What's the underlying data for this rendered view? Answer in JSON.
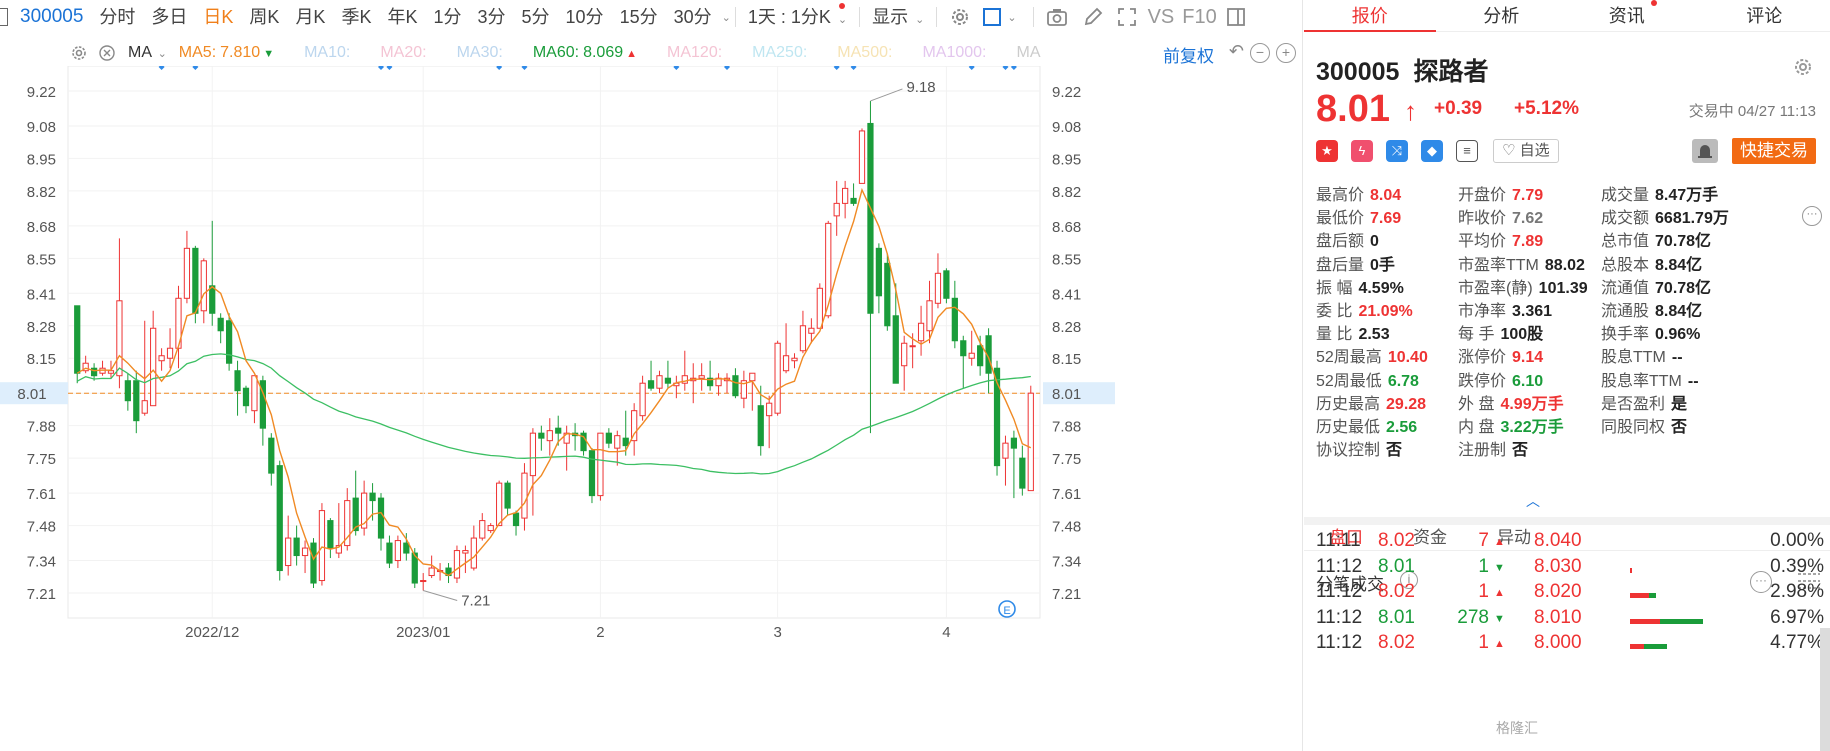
{
  "toolbar": {
    "code": "300005",
    "periods": [
      "分时",
      "多日",
      "日K",
      "周K",
      "月K",
      "季K",
      "年K",
      "1分",
      "3分",
      "5分",
      "10分",
      "15分",
      "30分"
    ],
    "active_period": "日K",
    "interval": "1天 : 1分K",
    "display": "显示",
    "vs": "VS",
    "f10": "F10"
  },
  "ma_bar": {
    "label": "MA",
    "items": [
      {
        "text": "MA5:",
        "value": "7.810",
        "color": "#f08a24",
        "marker": "▼",
        "marker_color": "#1a9c3a"
      },
      {
        "text": "MA10:",
        "value": "",
        "color": "#bcd6ee"
      },
      {
        "text": "MA20:",
        "value": "",
        "color": "#f4c4d4"
      },
      {
        "text": "MA30:",
        "value": "",
        "color": "#bcd6ee"
      },
      {
        "text": "MA60:",
        "value": "8.069",
        "color": "#1a9c3a",
        "marker": "▲",
        "marker_color": "#e33"
      },
      {
        "text": "MA120:",
        "value": "",
        "color": "#f4c4d4"
      },
      {
        "text": "MA250:",
        "value": "",
        "color": "#bfe6f1"
      },
      {
        "text": "MA500:",
        "value": "",
        "color": "#f6e3b4"
      },
      {
        "text": "MA1000:",
        "value": "",
        "color": "#e3c6ee"
      },
      {
        "text": "MA",
        "value": "",
        "color": "#ccc"
      }
    ],
    "adjust": "前复权"
  },
  "chart_data": {
    "type": "candlestick",
    "y_ticks": [
      "9.22",
      "9.08",
      "8.95",
      "8.82",
      "8.68",
      "8.55",
      "8.41",
      "8.28",
      "8.15",
      "8.01",
      "7.88",
      "7.75",
      "7.61",
      "7.48",
      "7.34",
      "7.21"
    ],
    "x_labels": [
      "2022/12",
      "2023/01",
      "2",
      "3",
      "4"
    ],
    "current_price": "8.01",
    "annotations": {
      "high": "9.18",
      "low": "7.21"
    },
    "up_color": "#e33",
    "down_color": "#1a9c3a",
    "ylim": [
      7.11,
      9.32
    ],
    "candles": [
      [
        8.36,
        8.09,
        8.35,
        8.05
      ],
      [
        8.1,
        8.13,
        8.16,
        8.09
      ],
      [
        8.11,
        8.08,
        8.13,
        8.06
      ],
      [
        8.09,
        8.11,
        8.14,
        8.08
      ],
      [
        8.09,
        8.1,
        8.14,
        8.07
      ],
      [
        8.08,
        8.38,
        8.63,
        8.03
      ],
      [
        8.06,
        7.98,
        8.09,
        7.94
      ],
      [
        8.06,
        7.9,
        8.1,
        7.85
      ],
      [
        7.93,
        7.98,
        8.3,
        7.92
      ],
      [
        7.96,
        8.27,
        8.34,
        7.96
      ],
      [
        8.14,
        8.16,
        8.19,
        8.1
      ],
      [
        8.15,
        8.19,
        8.27,
        8.11
      ],
      [
        8.19,
        8.39,
        8.44,
        8.11
      ],
      [
        8.39,
        8.59,
        8.66,
        8.37
      ],
      [
        8.59,
        8.33,
        8.6,
        8.29
      ],
      [
        8.34,
        8.54,
        8.55,
        8.29
      ],
      [
        8.44,
        8.33,
        8.7,
        8.28
      ],
      [
        8.31,
        8.26,
        8.33,
        8.21
      ],
      [
        8.3,
        8.13,
        8.33,
        8.1
      ],
      [
        8.1,
        8.02,
        8.14,
        7.92
      ],
      [
        8.03,
        7.96,
        8.04,
        7.93
      ],
      [
        7.94,
        8.08,
        8.08,
        7.89
      ],
      [
        8.06,
        7.87,
        8.08,
        7.8
      ],
      [
        7.83,
        7.69,
        7.85,
        7.64
      ],
      [
        7.72,
        7.3,
        7.74,
        7.26
      ],
      [
        7.32,
        7.43,
        7.52,
        7.28
      ],
      [
        7.43,
        7.36,
        7.48,
        7.32
      ],
      [
        7.36,
        7.39,
        7.42,
        7.29
      ],
      [
        7.41,
        7.25,
        7.43,
        7.23
      ],
      [
        7.26,
        7.54,
        7.57,
        7.24
      ],
      [
        7.5,
        7.39,
        7.51,
        7.35
      ],
      [
        7.37,
        7.4,
        7.57,
        7.35
      ],
      [
        7.4,
        7.58,
        7.63,
        7.38
      ],
      [
        7.59,
        7.46,
        7.7,
        7.44
      ],
      [
        7.47,
        7.61,
        7.66,
        7.44
      ],
      [
        7.61,
        7.58,
        7.65,
        7.5
      ],
      [
        7.59,
        7.43,
        7.61,
        7.38
      ],
      [
        7.41,
        7.33,
        7.44,
        7.31
      ],
      [
        7.34,
        7.42,
        7.44,
        7.31
      ],
      [
        7.41,
        7.37,
        7.45,
        7.34
      ],
      [
        7.37,
        7.25,
        7.39,
        7.23
      ],
      [
        7.26,
        7.26,
        7.29,
        7.22
      ],
      [
        7.28,
        7.31,
        7.36,
        7.27
      ],
      [
        7.3,
        7.3,
        7.33,
        7.26
      ],
      [
        7.31,
        7.28,
        7.33,
        7.25
      ],
      [
        7.27,
        7.38,
        7.4,
        7.25
      ],
      [
        7.37,
        7.38,
        7.4,
        7.29
      ],
      [
        7.31,
        7.43,
        7.48,
        7.3
      ],
      [
        7.43,
        7.5,
        7.53,
        7.42
      ],
      [
        7.46,
        7.48,
        7.49,
        7.45
      ],
      [
        7.48,
        7.65,
        7.66,
        7.48
      ],
      [
        7.65,
        7.55,
        7.66,
        7.52
      ],
      [
        7.53,
        7.48,
        7.54,
        7.44
      ],
      [
        7.51,
        7.69,
        7.73,
        7.46
      ],
      [
        7.68,
        7.85,
        7.87,
        7.52
      ],
      [
        7.85,
        7.83,
        7.88,
        7.78
      ],
      [
        7.82,
        7.86,
        7.91,
        7.76
      ],
      [
        7.87,
        7.85,
        7.92,
        7.8
      ],
      [
        7.81,
        7.85,
        7.88,
        7.7
      ],
      [
        7.85,
        7.84,
        7.89,
        7.78
      ],
      [
        7.85,
        7.78,
        7.86,
        7.76
      ],
      [
        7.78,
        7.6,
        7.79,
        7.57
      ],
      [
        7.6,
        7.85,
        7.85,
        7.58
      ],
      [
        7.85,
        7.81,
        7.87,
        7.79
      ],
      [
        7.79,
        7.84,
        7.86,
        7.72
      ],
      [
        7.83,
        7.8,
        7.94,
        7.76
      ],
      [
        7.82,
        7.94,
        7.97,
        7.76
      ],
      [
        7.92,
        8.05,
        8.08,
        7.9
      ],
      [
        8.06,
        8.03,
        8.14,
        8.02
      ],
      [
        8.03,
        8.08,
        8.1,
        8.01
      ],
      [
        8.07,
        8.05,
        8.14,
        8.03
      ],
      [
        8.04,
        8.05,
        8.08,
        7.99
      ],
      [
        8.05,
        8.08,
        8.18,
        8.02
      ],
      [
        8.06,
        8.07,
        8.13,
        7.97
      ],
      [
        8.07,
        8.08,
        8.13,
        8.02
      ],
      [
        8.07,
        8.04,
        8.14,
        8.02
      ],
      [
        8.04,
        8.07,
        8.09,
        8.0
      ],
      [
        8.06,
        8.07,
        8.09,
        8.01
      ],
      [
        8.08,
        8.0,
        8.11,
        7.99
      ],
      [
        7.99,
        8.06,
        8.1,
        7.95
      ],
      [
        8.06,
        8.09,
        8.09,
        7.94
      ],
      [
        7.96,
        7.8,
        8.04,
        7.76
      ],
      [
        7.92,
        7.97,
        8.0,
        7.79
      ],
      [
        7.93,
        8.21,
        8.22,
        7.92
      ],
      [
        8.1,
        8.16,
        8.29,
        8.09
      ],
      [
        8.14,
        8.15,
        8.17,
        8.11
      ],
      [
        8.18,
        8.28,
        8.34,
        8.17
      ],
      [
        8.25,
        8.27,
        8.31,
        8.21
      ],
      [
        8.27,
        8.43,
        8.45,
        8.27
      ],
      [
        8.32,
        8.69,
        8.7,
        8.31
      ],
      [
        8.72,
        8.77,
        8.86,
        8.64
      ],
      [
        8.77,
        8.83,
        8.86,
        8.71
      ],
      [
        8.79,
        8.77,
        8.85,
        8.76
      ],
      [
        8.85,
        9.06,
        9.07,
        8.85
      ],
      [
        9.09,
        8.33,
        9.18,
        7.85
      ],
      [
        8.59,
        8.4,
        8.61,
        8.33
      ],
      [
        8.53,
        8.28,
        8.57,
        8.26
      ],
      [
        8.32,
        8.05,
        8.45,
        8.05
      ],
      [
        8.12,
        8.21,
        8.24,
        8.02
      ],
      [
        8.2,
        8.2,
        8.25,
        8.11
      ],
      [
        8.22,
        8.29,
        8.36,
        8.16
      ],
      [
        8.26,
        8.38,
        8.46,
        8.21
      ],
      [
        8.37,
        8.49,
        8.57,
        8.35
      ],
      [
        8.5,
        8.39,
        8.51,
        8.37
      ],
      [
        8.39,
        8.22,
        8.46,
        8.19
      ],
      [
        8.22,
        8.16,
        8.24,
        8.03
      ],
      [
        8.15,
        8.17,
        8.26,
        8.12
      ],
      [
        8.2,
        8.12,
        8.24,
        8.08
      ],
      [
        8.24,
        8.09,
        8.27,
        8.01
      ],
      [
        8.11,
        7.72,
        8.14,
        7.68
      ],
      [
        7.75,
        7.81,
        7.84,
        7.64
      ],
      [
        7.83,
        7.79,
        7.86,
        7.59
      ],
      [
        7.75,
        7.63,
        7.8,
        7.6
      ],
      [
        7.62,
        8.01,
        8.04,
        7.69
      ]
    ]
  },
  "right": {
    "tabs": [
      "报价",
      "分析",
      "资讯",
      "评论"
    ],
    "active_tab": "报价",
    "code": "300005",
    "name": "探路者",
    "price": "8.01",
    "change": "+0.39",
    "change_pct": "+5.12%",
    "status": "交易中 04/27 11:13",
    "watch_label": "自选",
    "quick_trade": "快捷交易",
    "stats": [
      [
        {
          "label": "最高价",
          "value": "8.04",
          "color": "red"
        },
        {
          "label": "开盘价",
          "value": "7.79",
          "color": "red"
        },
        {
          "label": "成交量",
          "value": "8.47万手",
          "color": "dark"
        }
      ],
      [
        {
          "label": "最低价",
          "value": "7.69",
          "color": "red"
        },
        {
          "label": "昨收价",
          "value": "7.62",
          "color": "gray"
        },
        {
          "label": "成交额",
          "value": "6681.79万",
          "color": "dark"
        }
      ],
      [
        {
          "label": "盘后额",
          "value": "0",
          "color": "dark"
        },
        {
          "label": "平均价",
          "value": "7.89",
          "color": "red"
        },
        {
          "label": "总市值",
          "value": "70.78亿",
          "color": "dark"
        }
      ],
      [
        {
          "label": "盘后量",
          "value": "0手",
          "color": "dark"
        },
        {
          "label": "市盈率TTM",
          "value": "88.02",
          "color": "dark"
        },
        {
          "label": "总股本",
          "value": "8.84亿",
          "color": "dark"
        }
      ],
      [
        {
          "label": "振 幅",
          "value": "4.59%",
          "color": "dark"
        },
        {
          "label": "市盈率(静)",
          "value": "101.39",
          "color": "dark"
        },
        {
          "label": "流通值",
          "value": "70.78亿",
          "color": "dark"
        }
      ],
      [
        {
          "label": "委 比",
          "value": "21.09%",
          "color": "red"
        },
        {
          "label": "市净率",
          "value": "3.361",
          "color": "dark"
        },
        {
          "label": "流通股",
          "value": "8.84亿",
          "color": "dark"
        }
      ],
      [
        {
          "label": "量 比",
          "value": "2.53",
          "color": "dark"
        },
        {
          "label": "每 手",
          "value": "100股",
          "color": "dark"
        },
        {
          "label": "换手率",
          "value": "0.96%",
          "color": "dark"
        }
      ],
      [
        {
          "label": "52周最高",
          "value": "10.40",
          "color": "red"
        },
        {
          "label": "涨停价",
          "value": "9.14",
          "color": "red"
        },
        {
          "label": "股息TTM",
          "value": "--",
          "color": "dark"
        }
      ],
      [
        {
          "label": "52周最低",
          "value": "6.78",
          "color": "green"
        },
        {
          "label": "跌停价",
          "value": "6.10",
          "color": "green"
        },
        {
          "label": "股息率TTM",
          "value": "--",
          "color": "dark"
        }
      ],
      [
        {
          "label": "历史最高",
          "value": "29.28",
          "color": "red"
        },
        {
          "label": "外 盘",
          "value": "4.99万手",
          "color": "red"
        },
        {
          "label": "是否盈利",
          "value": "是",
          "color": "dark"
        }
      ],
      [
        {
          "label": "历史最低",
          "value": "2.56",
          "color": "green"
        },
        {
          "label": "内 盘",
          "value": "3.22万手",
          "color": "green"
        },
        {
          "label": "同股同权",
          "value": "否",
          "color": "dark"
        }
      ],
      [
        {
          "label": "协议控制",
          "value": "否",
          "color": "dark"
        },
        {
          "label": "注册制",
          "value": "否",
          "color": "dark"
        },
        null
      ]
    ],
    "subtabs": [
      "盘口",
      "资金",
      "异动"
    ],
    "active_subtab": "盘口",
    "fb_title": "分笔成交",
    "trades": [
      {
        "time": "11:11",
        "price": "8.02",
        "vol": "7",
        "dir": "up"
      },
      {
        "time": "11:12",
        "price": "8.01",
        "vol": "1",
        "dir": "down"
      },
      {
        "time": "11:12",
        "price": "8.02",
        "vol": "1",
        "dir": "up"
      },
      {
        "time": "11:12",
        "price": "8.01",
        "vol": "278",
        "dir": "down"
      },
      {
        "time": "11:12",
        "price": "8.02",
        "vol": "1",
        "dir": "up"
      }
    ],
    "ladder": [
      {
        "price": "8.040",
        "pct": "0.00%",
        "red": 0,
        "green": 0
      },
      {
        "price": "8.030",
        "pct": "0.39%",
        "red": 0.2,
        "green": 0
      },
      {
        "price": "8.020",
        "pct": "2.98%",
        "red": 1.6,
        "green": 0.55
      },
      {
        "price": "8.010",
        "pct": "6.97%",
        "red": 2.5,
        "green": 3.6
      },
      {
        "price": "8.000",
        "pct": "4.77%",
        "red": 1.2,
        "green": 1.9
      }
    ],
    "watermark": "格隆汇"
  }
}
